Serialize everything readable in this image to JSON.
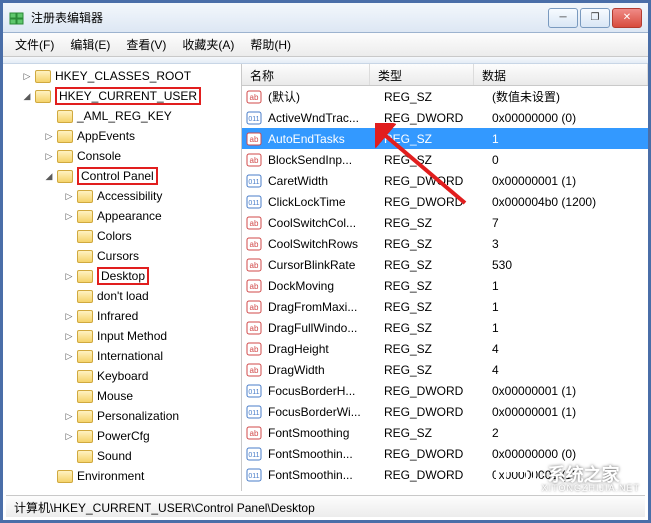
{
  "window": {
    "title": "注册表编辑器",
    "min_label": "─",
    "max_label": "❐",
    "close_label": "✕"
  },
  "menu": {
    "items": [
      "文件(F)",
      "编辑(E)",
      "查看(V)",
      "收藏夹(A)",
      "帮助(H)"
    ]
  },
  "tree": {
    "nodes": [
      {
        "label": "HKEY_CLASSES_ROOT",
        "indent": 1,
        "expander": "▷",
        "highlight": false
      },
      {
        "label": "HKEY_CURRENT_USER",
        "indent": 1,
        "expander": "◢",
        "highlight": true
      },
      {
        "label": "_AML_REG_KEY",
        "indent": 2,
        "expander": "",
        "highlight": false
      },
      {
        "label": "AppEvents",
        "indent": 2,
        "expander": "▷",
        "highlight": false
      },
      {
        "label": "Console",
        "indent": 2,
        "expander": "▷",
        "highlight": false
      },
      {
        "label": "Control Panel",
        "indent": 2,
        "expander": "◢",
        "highlight": true
      },
      {
        "label": "Accessibility",
        "indent": 3,
        "expander": "▷",
        "highlight": false
      },
      {
        "label": "Appearance",
        "indent": 3,
        "expander": "▷",
        "highlight": false
      },
      {
        "label": "Colors",
        "indent": 3,
        "expander": "",
        "highlight": false
      },
      {
        "label": "Cursors",
        "indent": 3,
        "expander": "",
        "highlight": false
      },
      {
        "label": "Desktop",
        "indent": 3,
        "expander": "▷",
        "highlight": true
      },
      {
        "label": "don't load",
        "indent": 3,
        "expander": "",
        "highlight": false
      },
      {
        "label": "Infrared",
        "indent": 3,
        "expander": "▷",
        "highlight": false
      },
      {
        "label": "Input Method",
        "indent": 3,
        "expander": "▷",
        "highlight": false
      },
      {
        "label": "International",
        "indent": 3,
        "expander": "▷",
        "highlight": false
      },
      {
        "label": "Keyboard",
        "indent": 3,
        "expander": "",
        "highlight": false
      },
      {
        "label": "Mouse",
        "indent": 3,
        "expander": "",
        "highlight": false
      },
      {
        "label": "Personalization",
        "indent": 3,
        "expander": "▷",
        "highlight": false
      },
      {
        "label": "PowerCfg",
        "indent": 3,
        "expander": "▷",
        "highlight": false
      },
      {
        "label": "Sound",
        "indent": 3,
        "expander": "",
        "highlight": false
      },
      {
        "label": "Environment",
        "indent": 2,
        "expander": "",
        "highlight": false
      }
    ]
  },
  "list": {
    "columns": {
      "name": "名称",
      "type": "类型",
      "data": "数据"
    },
    "rows": [
      {
        "name": "(默认)",
        "type": "REG_SZ",
        "data": "(数值未设置)",
        "icon": "string",
        "selected": false
      },
      {
        "name": "ActiveWndTrac...",
        "type": "REG_DWORD",
        "data": "0x00000000 (0)",
        "icon": "dword",
        "selected": false
      },
      {
        "name": "AutoEndTasks",
        "type": "REG_SZ",
        "data": "1",
        "icon": "string",
        "selected": true
      },
      {
        "name": "BlockSendInp...",
        "type": "REG_SZ",
        "data": "0",
        "icon": "string",
        "selected": false
      },
      {
        "name": "CaretWidth",
        "type": "REG_DWORD",
        "data": "0x00000001 (1)",
        "icon": "dword",
        "selected": false
      },
      {
        "name": "ClickLockTime",
        "type": "REG_DWORD",
        "data": "0x000004b0 (1200)",
        "icon": "dword",
        "selected": false
      },
      {
        "name": "CoolSwitchCol...",
        "type": "REG_SZ",
        "data": "7",
        "icon": "string",
        "selected": false
      },
      {
        "name": "CoolSwitchRows",
        "type": "REG_SZ",
        "data": "3",
        "icon": "string",
        "selected": false
      },
      {
        "name": "CursorBlinkRate",
        "type": "REG_SZ",
        "data": "530",
        "icon": "string",
        "selected": false
      },
      {
        "name": "DockMoving",
        "type": "REG_SZ",
        "data": "1",
        "icon": "string",
        "selected": false
      },
      {
        "name": "DragFromMaxi...",
        "type": "REG_SZ",
        "data": "1",
        "icon": "string",
        "selected": false
      },
      {
        "name": "DragFullWindo...",
        "type": "REG_SZ",
        "data": "1",
        "icon": "string",
        "selected": false
      },
      {
        "name": "DragHeight",
        "type": "REG_SZ",
        "data": "4",
        "icon": "string",
        "selected": false
      },
      {
        "name": "DragWidth",
        "type": "REG_SZ",
        "data": "4",
        "icon": "string",
        "selected": false
      },
      {
        "name": "FocusBorderH...",
        "type": "REG_DWORD",
        "data": "0x00000001 (1)",
        "icon": "dword",
        "selected": false
      },
      {
        "name": "FocusBorderWi...",
        "type": "REG_DWORD",
        "data": "0x00000001 (1)",
        "icon": "dword",
        "selected": false
      },
      {
        "name": "FontSmoothing",
        "type": "REG_SZ",
        "data": "2",
        "icon": "string",
        "selected": false
      },
      {
        "name": "FontSmoothin...",
        "type": "REG_DWORD",
        "data": "0x00000000 (0)",
        "icon": "dword",
        "selected": false
      },
      {
        "name": "FontSmoothin...",
        "type": "REG_DWORD",
        "data": "0x00000001 (1)",
        "icon": "dword",
        "selected": false
      }
    ]
  },
  "statusbar": {
    "path": "计算机\\HKEY_CURRENT_USER\\Control Panel\\Desktop"
  },
  "watermark": {
    "zh": "·系统之家",
    "en": "XITONGZHIJIA.NET"
  }
}
